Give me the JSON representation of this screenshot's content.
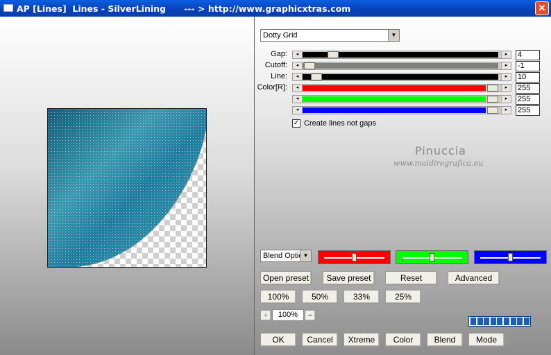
{
  "window": {
    "title": "AP [Lines]  Lines - SilverLining      --- > http://www.graphicxtras.com",
    "close_glyph": "✕"
  },
  "preset_dropdown": {
    "value": "Dotty Grid"
  },
  "parameters": [
    {
      "label": "Gap:",
      "value": "4",
      "color": "#000000"
    },
    {
      "label": "Cutoff:",
      "value": "-1",
      "color": "#808080"
    },
    {
      "label": "Line:",
      "value": "10",
      "color": "#000000"
    },
    {
      "label": "Color[R]:",
      "value": "255",
      "color": "#ff0000"
    },
    {
      "label": "",
      "value": "255",
      "color": "#00ff00"
    },
    {
      "label": "",
      "value": "255",
      "color": "#0000ff"
    }
  ],
  "checkbox": {
    "label": "Create lines not gaps",
    "checked": true,
    "mark": "✓"
  },
  "watermark": {
    "name": "Pinuccia",
    "url": "www.maidiregrafica.eu"
  },
  "blend_dropdown": {
    "value": "Blend Options"
  },
  "color_boxes": [
    {
      "name": "red",
      "color": "#ff0000"
    },
    {
      "name": "green",
      "color": "#00ff00"
    },
    {
      "name": "blue",
      "color": "#0000ff"
    }
  ],
  "buttons": {
    "open_preset": "Open preset",
    "save_preset": "Save preset",
    "reset": "Reset",
    "advanced": "Advanced",
    "zoom_100": "100%",
    "zoom_50": "50%",
    "zoom_33": "33%",
    "zoom_25": "25%",
    "ok": "OK",
    "cancel": "Cancel",
    "xtreme": "Xtreme",
    "color": "Color",
    "blend": "Blend",
    "mode": "Mode"
  },
  "zoom": {
    "plus": "+",
    "value": "100%",
    "minus": "−"
  },
  "progress": {
    "segments": 9
  }
}
